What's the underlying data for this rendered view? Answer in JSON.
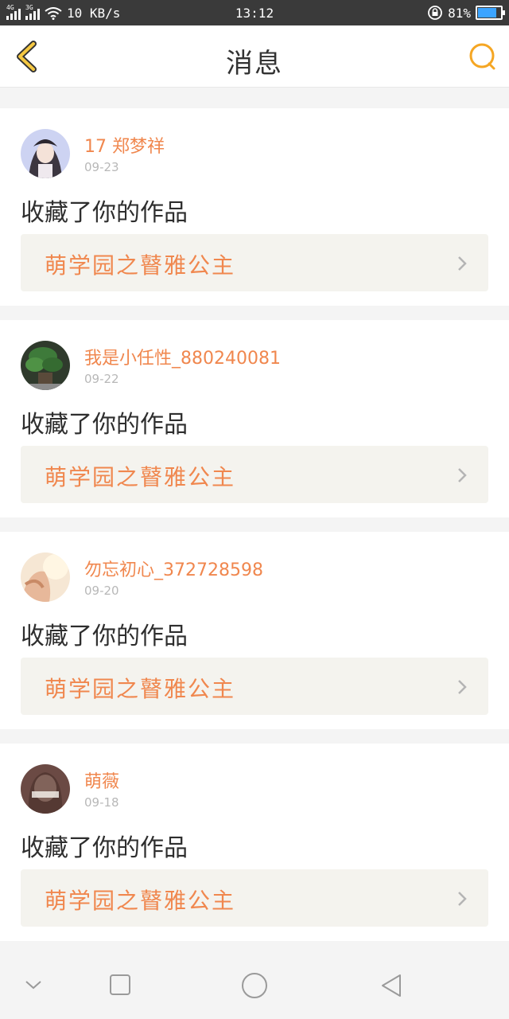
{
  "status_bar": {
    "network_left": "4G",
    "network_right": "3G",
    "speed": "10 KB/s",
    "time": "13:12",
    "battery_percent": "81%",
    "battery_level": 0.81
  },
  "header": {
    "title": "消息",
    "back_icon": "back-chevron-icon",
    "search_icon": "search-icon",
    "accent_color": "#f5a623"
  },
  "messages": [
    {
      "username": "17 郑梦祥",
      "date": "09-23",
      "action": "收藏了你的作品",
      "work_title": "萌学园之瞽雅公主"
    },
    {
      "username": "我是小任性_880240081",
      "date": "09-22",
      "action": "收藏了你的作品",
      "work_title": "萌学园之瞽雅公主"
    },
    {
      "username": "勿忘初心_372728598",
      "date": "09-20",
      "action": "收藏了你的作品",
      "work_title": "萌学园之瞽雅公主"
    },
    {
      "username": "萌薇",
      "date": "09-18",
      "action": "收藏了你的作品",
      "work_title": "萌学园之瞽雅公主"
    }
  ],
  "colors": {
    "username": "#f0874e",
    "link_bg": "#f4f3ee",
    "status_bar_bg": "#3a3a3a"
  },
  "navbar": {
    "icons": [
      "collapse-chevron-icon",
      "recents-square-icon",
      "home-circle-icon",
      "back-triangle-icon"
    ]
  }
}
